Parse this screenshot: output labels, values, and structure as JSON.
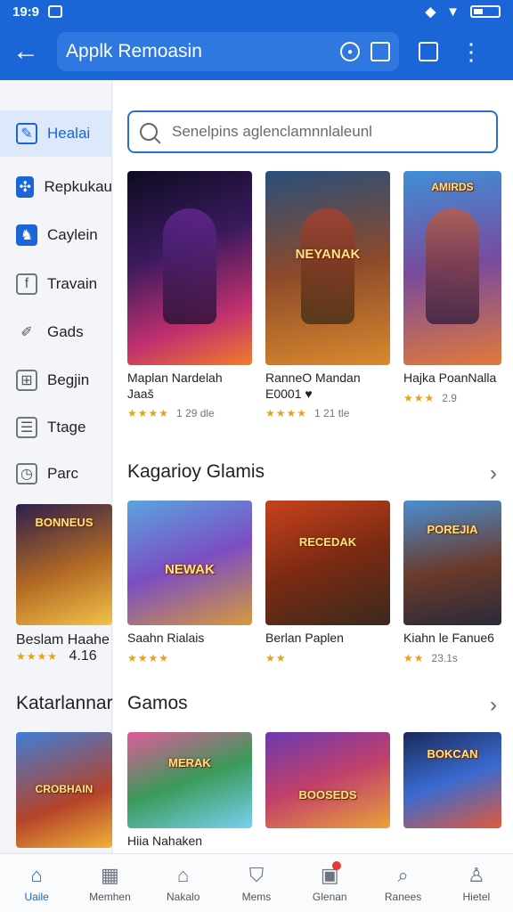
{
  "status": {
    "time": "19:9"
  },
  "appbar": {
    "title": "Applk Remoasin"
  },
  "search": {
    "placeholder": "Senelpins aglenclamnnlaleunl"
  },
  "sidebar": {
    "items": [
      {
        "label": "Healai",
        "icon": "leaf-icon",
        "active": true
      },
      {
        "label": "Repkukau",
        "icon": "puzzle-icon"
      },
      {
        "label": "Caylein",
        "icon": "character-icon"
      },
      {
        "label": "Travain",
        "icon": "flag-icon"
      },
      {
        "label": "Gads",
        "icon": "pencil-icon"
      },
      {
        "label": "Begjin",
        "icon": "grid-icon"
      },
      {
        "label": "Ttage",
        "icon": "list-icon"
      },
      {
        "label": "Parc",
        "icon": "clock-icon"
      }
    ],
    "card1": {
      "title": "Beslam Haahe",
      "rating": "4.16"
    },
    "section": "Katarlannar",
    "card2": {
      "title": ""
    }
  },
  "row1": {
    "cards": [
      {
        "title": "Maplan Nardelah Jaaš",
        "rating": "1 29 dle",
        "stars": "★★★★"
      },
      {
        "title": "RanneO Mandan E0001 ♥",
        "rating": "1 21 tle",
        "stars": "★★★★"
      },
      {
        "title": "Hajka PoanNalla",
        "rating": "2.9",
        "stars": "★★★"
      }
    ]
  },
  "row2": {
    "title": "Kagarioy Glamis",
    "cards": [
      {
        "title": "Saahn Rialais",
        "rating": "",
        "stars": "★★★★"
      },
      {
        "title": "Berlan Paplen",
        "rating": "",
        "stars": "★★"
      },
      {
        "title": "Kiahn le Fanue6",
        "rating": "23.1s",
        "stars": "★★"
      }
    ]
  },
  "row3": {
    "title": "Gamos",
    "cards": [
      {
        "title": "Hiia Nahaken"
      },
      {
        "title": ""
      },
      {
        "title": ""
      }
    ]
  },
  "bottomnav": {
    "items": [
      {
        "label": "Uaile",
        "icon": "home-icon",
        "active": true
      },
      {
        "label": "Memhen",
        "icon": "calendar-icon"
      },
      {
        "label": "Nakalo",
        "icon": "house-icon"
      },
      {
        "label": "Mems",
        "icon": "shield-icon"
      },
      {
        "label": "Glenan",
        "icon": "image-icon",
        "badge": true
      },
      {
        "label": "Ranees",
        "icon": "search-icon"
      },
      {
        "label": "Hietel",
        "icon": "person-icon"
      }
    ]
  },
  "colors": {
    "primary": "#1a66d6",
    "star": "#e6a21a",
    "badge": "#e53935"
  }
}
